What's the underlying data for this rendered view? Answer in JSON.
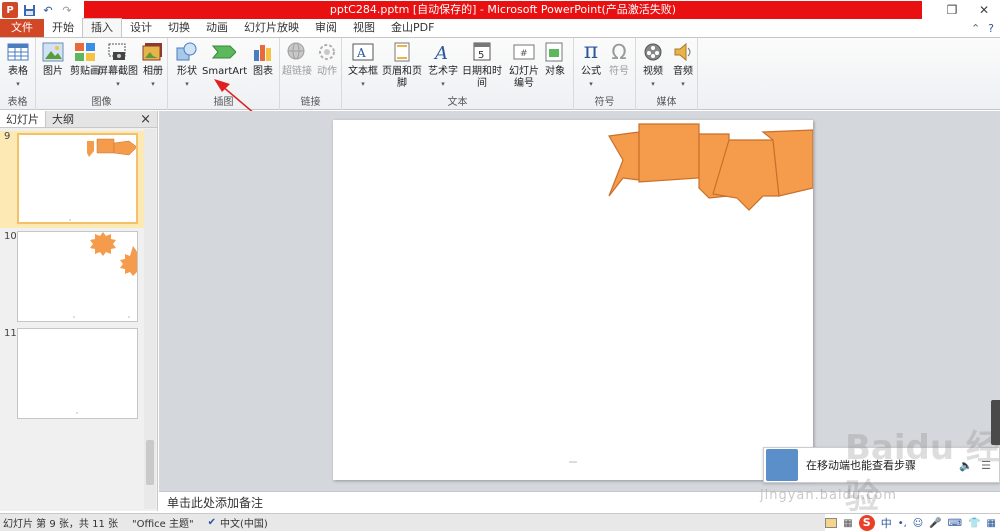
{
  "window": {
    "title": "pptC284.pptm [自动保存的] - Microsoft PowerPoint(产品激活失败)"
  },
  "quick_access": {
    "app_icon": "P",
    "save_icon": "floppy-icon",
    "undo_icon": "undo-icon",
    "redo_icon": "redo-icon"
  },
  "tabs": [
    "文件",
    "开始",
    "插入",
    "设计",
    "切换",
    "动画",
    "幻灯片放映",
    "审阅",
    "视图",
    "金山PDF"
  ],
  "active_tab": "插入",
  "ribbon": {
    "groups": [
      {
        "label": "表格",
        "buttons": [
          {
            "label": "表格"
          }
        ]
      },
      {
        "label": "图像",
        "buttons": [
          {
            "label": "图片"
          },
          {
            "label": "剪贴画"
          },
          {
            "label": "屏幕截图"
          },
          {
            "label": "相册"
          }
        ]
      },
      {
        "label": "插图",
        "buttons": [
          {
            "label": "形状"
          },
          {
            "label": "SmartArt"
          },
          {
            "label": "图表"
          }
        ]
      },
      {
        "label": "链接",
        "buttons": [
          {
            "label": "超链接"
          },
          {
            "label": "动作"
          }
        ]
      },
      {
        "label": "文本",
        "buttons": [
          {
            "label": "文本框"
          },
          {
            "label": "页眉和页脚"
          },
          {
            "label": "艺术字"
          },
          {
            "label": "日期和时间"
          },
          {
            "label": "幻灯片编号"
          },
          {
            "label": "对象"
          }
        ]
      },
      {
        "label": "符号",
        "buttons": [
          {
            "label": "公式"
          },
          {
            "label": "符号"
          }
        ]
      },
      {
        "label": "媒体",
        "buttons": [
          {
            "label": "视频"
          },
          {
            "label": "音频"
          }
        ]
      }
    ]
  },
  "left_pane": {
    "tabs": [
      "幻灯片",
      "大纲"
    ],
    "close": "×",
    "slides": [
      {
        "number": "9"
      },
      {
        "number": "10"
      },
      {
        "number": "11"
      }
    ]
  },
  "notes_placeholder": "单击此处添加备注",
  "status": {
    "slide_info": "幻灯片 第 9 张，共 11 张",
    "theme": "\"Office 主题\"",
    "language": "中文(中国)"
  },
  "ime": {
    "label": "中"
  },
  "popup": {
    "text": "在移动端也能查看步骤"
  },
  "watermark": {
    "text": "Baidu 经验",
    "url": "jingyan.baidu.com"
  },
  "colors": {
    "file_tab": "#d24726",
    "title_bar_highlight": "#e81010",
    "banner_fill": "#f59b4c",
    "banner_stroke": "#c8702a"
  }
}
